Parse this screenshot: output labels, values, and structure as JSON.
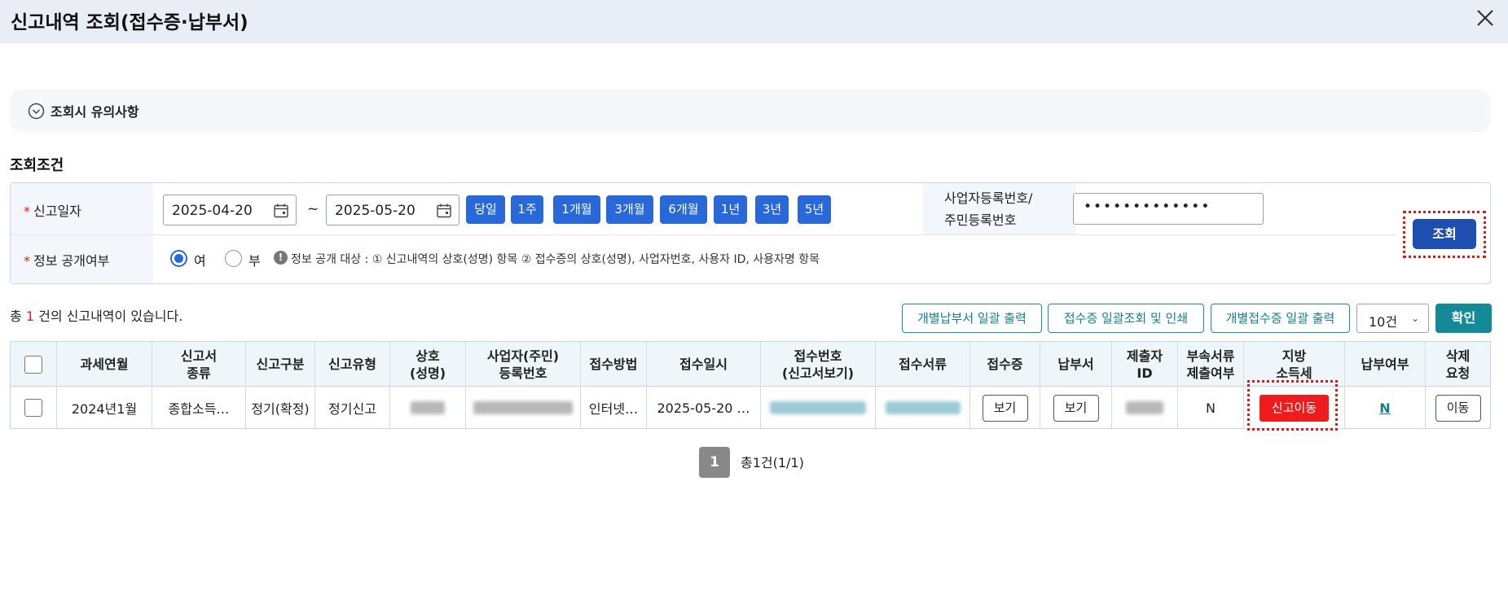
{
  "window": {
    "title": "신고내역 조회(접수증·납부서)"
  },
  "notice": {
    "label": "조회시 유의사항"
  },
  "conditions": {
    "title": "조회조건",
    "report_date_label": "신고일자",
    "date_from": "2025-04-20",
    "date_to": "2025-05-20",
    "tilde": "~",
    "periods": [
      "당일",
      "1주",
      "1개월",
      "3개월",
      "6개월",
      "1년",
      "3년",
      "5년"
    ],
    "biz_label_line1": "사업자등록번호/",
    "biz_label_line2": "주민등록번호",
    "biz_value": "•••••••••••••",
    "disclosure_label": "정보 공개여부",
    "yes_label": "여",
    "no_label": "부",
    "disclosure_selected": "여",
    "info_mark": "!",
    "info_text": "정보 공개 대상 : ① 신고내역의 상호(성명) 항목 ② 접수증의 상호(성명), 사업자번호, 사용자 ID, 사용자명 항목",
    "search_label": "조회"
  },
  "results": {
    "total_prefix": "총",
    "total_count": "1",
    "total_suffix": "건의 신고내역이 있습니다.",
    "actions": [
      "개별납부서 일괄 출력",
      "접수증 일괄조회 및 인쇄",
      "개별접수증 일괄 출력"
    ],
    "page_size": "10건",
    "confirm_label": "확인"
  },
  "table": {
    "headers": [
      "",
      "과세연월",
      "신고서\n종류",
      "신고구분",
      "신고유형",
      "상호\n(성명)",
      "사업자(주민)\n등록번호",
      "접수방법",
      "접수일시",
      "접수번호\n(신고서보기)",
      "접수서류",
      "접수증",
      "납부서",
      "제출자\nID",
      "부속서류\n제출여부",
      "지방\n소득세",
      "납부여부",
      "삭제\n요청"
    ],
    "row": {
      "tax_period": "2024년1월",
      "form_type": "종합소득…",
      "report_class": "정기(확정)",
      "report_type": "정기신고",
      "method": "인터넷…",
      "datetime": "2025-05-20 …",
      "receipt_btn": "보기",
      "payment_btn": "보기",
      "attach_submitted": "N",
      "local_tax_btn": "신고이동",
      "paid": "N",
      "delete_btn": "이동"
    }
  },
  "pagination": {
    "current": "1",
    "summary": "총1건(1/1)"
  },
  "colors": {
    "primary_blue": "#2868d8",
    "search_blue": "#1e4fb0",
    "teal": "#148a96",
    "alert_red": "#ee1c1c",
    "highlight_border": "#e01818"
  }
}
